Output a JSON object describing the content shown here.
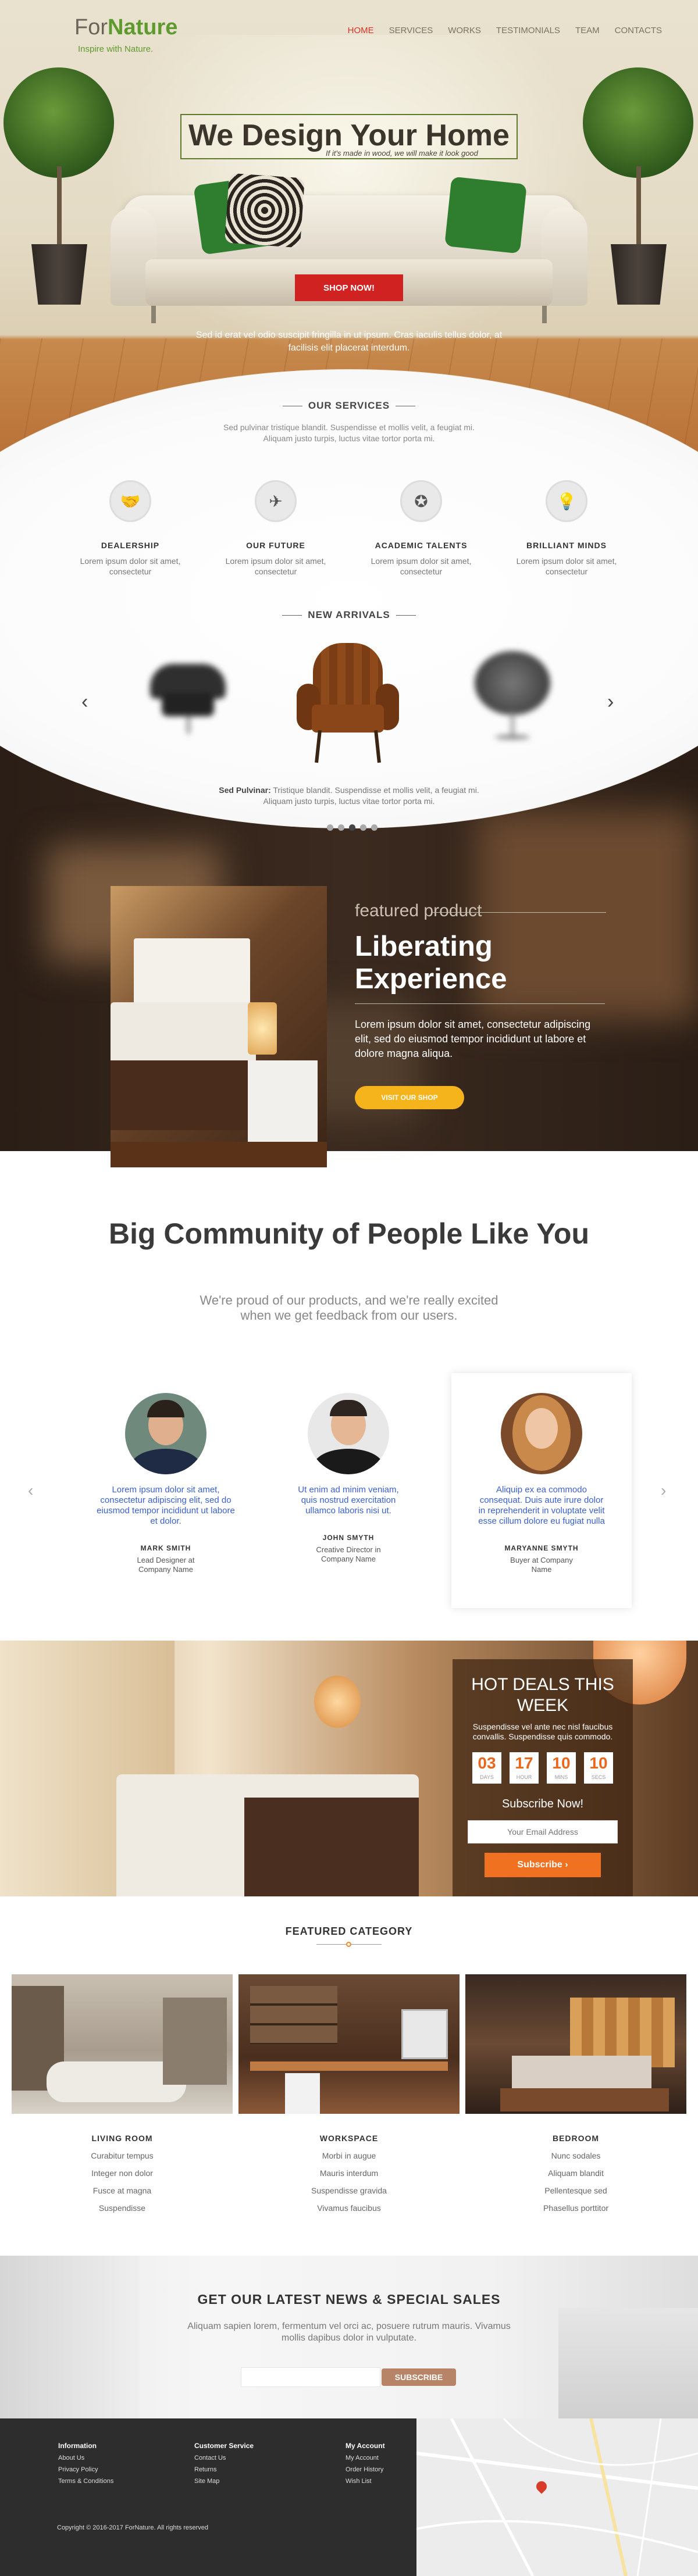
{
  "brand": {
    "logo_light": "For",
    "logo_bold": "Nature",
    "tagline": "Inspire with Nature."
  },
  "nav": [
    "HOME",
    "SERVICES",
    "WORKS",
    "TESTIMONIALS",
    "TEAM",
    "CONTACTS"
  ],
  "nav_active": "HOME",
  "hero": {
    "title": "We Design Your Home",
    "subtitle": "If it's made in wood, we will make it look good",
    "cta": "SHOP NOW!",
    "text": "Sed id erat vel odio suscipit fringilla in ut ipsum. Cras iaculis tellus dolor, at facilisis elit placerat interdum."
  },
  "services": {
    "title": "OUR SERVICES",
    "text": "Sed pulvinar tristique blandit. Suspendisse et mollis velit, a feugiat mi. Aliquam justo turpis, luctus vitae tortor porta mi.",
    "items": [
      {
        "name": "DEALERSHIP",
        "desc": "Lorem ipsum dolor sit amet, consectetur",
        "icon": "handshake-icon",
        "glyph": "🤝"
      },
      {
        "name": "OUR FUTURE",
        "desc": "Lorem ipsum dolor sit amet, consectetur",
        "icon": "paper-plane-icon",
        "glyph": "✈"
      },
      {
        "name": "ACADEMIC TALENTS",
        "desc": "Lorem ipsum dolor sit amet, consectetur",
        "icon": "award-icon",
        "glyph": "✪"
      },
      {
        "name": "BRILLIANT MINDS",
        "desc": "Lorem ipsum dolor sit amet, consectetur",
        "icon": "lightbulb-icon",
        "glyph": "💡"
      }
    ]
  },
  "arrivals": {
    "title": "NEW ARRIVALS",
    "caption_bold": "Sed Pulvinar:",
    "caption": "Tristique blandit. Suspendisse et mollis velit, a feugiat mi. Aliquam justo turpis, luctus vitae tortor porta mi.",
    "dots_count": 5,
    "active_dot": 2
  },
  "featured": {
    "label": "featured product",
    "title": "Liberating Experience",
    "text": "Lorem ipsum dolor sit amet, consectetur adipiscing elit, sed do eiusmod tempor incididunt ut labore et dolore magna aliqua.",
    "cta": "VISIT OUR SHOP"
  },
  "community": {
    "title": "Big Community of People Like You",
    "subtitle": "We're proud of our products, and we're really excited when we get feedback from our users.",
    "testimonials": [
      {
        "quote": "Lorem ipsum dolor sit amet, consectetur adipiscing elit, sed do eiusmod tempor incididunt ut labore et dolor.",
        "name": "MARK SMITH",
        "role": "Lead Designer at Company Name"
      },
      {
        "quote": "Ut enim ad minim veniam, quis nostrud exercitation ullamco laboris nisi ut.",
        "name": "JOHN SMYTH",
        "role": "Creative Director in Company Name"
      },
      {
        "quote": "Aliquip ex ea commodo consequat. Duis aute irure dolor in reprehenderit in voluptate velit esse cillum dolore eu fugiat nulla",
        "name": "MARYANNE SMYTH",
        "role": "Buyer at Company Name"
      }
    ]
  },
  "deals": {
    "title": "HOT DEALS THIS WEEK",
    "text": "Suspendisse vel ante nec nisl faucibus convallis. Suspendisse quis commodo.",
    "countdown": [
      {
        "value": "03",
        "unit": "DAYS"
      },
      {
        "value": "17",
        "unit": "HOUR"
      },
      {
        "value": "10",
        "unit": "MINS"
      },
      {
        "value": "10",
        "unit": "SECS"
      }
    ],
    "subscribe_title": "Subscribe Now!",
    "email_placeholder": "Your Email Address",
    "subscribe_btn": "Subscribe  ›"
  },
  "category": {
    "title": "FEATURED CATEGORY",
    "columns": [
      {
        "name": "LIVING ROOM",
        "items": [
          "Curabitur  tempus",
          "Integer non dolor",
          "Fusce at magna",
          "Suspendisse"
        ]
      },
      {
        "name": "WORKSPACE",
        "items": [
          "Morbi in augue",
          "Mauris interdum",
          "Suspendisse gravida",
          "Vivamus faucibus"
        ]
      },
      {
        "name": "BEDROOM",
        "items": [
          "Nunc sodales",
          "Aliquam blandit",
          "Pellentesque sed",
          "Phasellus porttitor"
        ]
      }
    ]
  },
  "newsletter": {
    "title": "GET OUR LATEST NEWS & SPECIAL SALES",
    "text": "Aliquam sapien lorem, fermentum vel orci ac, posuere rutrum mauris. Vivamus mollis dapibus dolor in vulputate.",
    "btn": "SUBSCRIBE"
  },
  "footer": {
    "columns": [
      {
        "title": "Information",
        "items": [
          "About Us",
          "Privacy Policy",
          "Terms & Conditions"
        ]
      },
      {
        "title": "Customer Service",
        "items": [
          "Contact Us",
          "Returns",
          "Site Map"
        ]
      },
      {
        "title": "My Account",
        "items": [
          "My Account",
          "Order History",
          "Wish List"
        ]
      }
    ],
    "copyright": "Copyright © 2016-2017 ForNature. All rights reserved"
  },
  "colors": {
    "accent_red": "#d12222",
    "brand_green": "#5e9a2f",
    "deal_orange": "#f0711f",
    "visit_yellow": "#f6b41c"
  }
}
